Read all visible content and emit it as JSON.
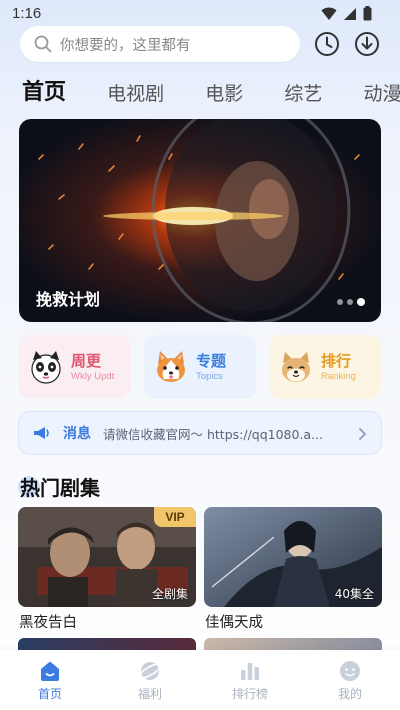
{
  "status": {
    "time": "1:16"
  },
  "search": {
    "placeholder": "你想要的，这里都有"
  },
  "tabs": [
    "首页",
    "电视剧",
    "电影",
    "综艺",
    "动漫"
  ],
  "banner": {
    "title": "挽救计划",
    "slide_count": 3,
    "active_slide": 3
  },
  "categories": [
    {
      "title": "周更",
      "subtitle": "Wkly Updt",
      "icon": "panda-dog-icon",
      "title_color": "#e2576f",
      "sub_color": "#e88a9a",
      "bg": "#fbeef2"
    },
    {
      "title": "专题",
      "subtitle": "Topics",
      "icon": "corgi-icon",
      "title_color": "#3b7fe0",
      "sub_color": "#7aa6e8",
      "bg": "#eaf3fd"
    },
    {
      "title": "排行",
      "subtitle": "Ranking",
      "icon": "shiba-icon",
      "title_color": "#e29a1e",
      "sub_color": "#e8b25a",
      "bg": "#fdf5e4"
    }
  ],
  "notice": {
    "label": "消息",
    "text": "请微信收藏官网～ https://qq1080.a..."
  },
  "section": {
    "title": "热门剧集"
  },
  "shows": [
    {
      "title": "黑夜告白",
      "badge": "VIP",
      "episodes": "全剧集"
    },
    {
      "title": "佳偶天成",
      "badge": "",
      "episodes": "40集全"
    }
  ],
  "nav": [
    {
      "label": "首页",
      "icon": "home-icon",
      "active": true
    },
    {
      "label": "福利",
      "icon": "planet-icon",
      "active": false
    },
    {
      "label": "排行榜",
      "icon": "bar-chart-icon",
      "active": false
    },
    {
      "label": "我的",
      "icon": "profile-face-icon",
      "active": false
    }
  ],
  "colors": {
    "accent": "#3c7be0",
    "vip": "#f1c66a"
  }
}
